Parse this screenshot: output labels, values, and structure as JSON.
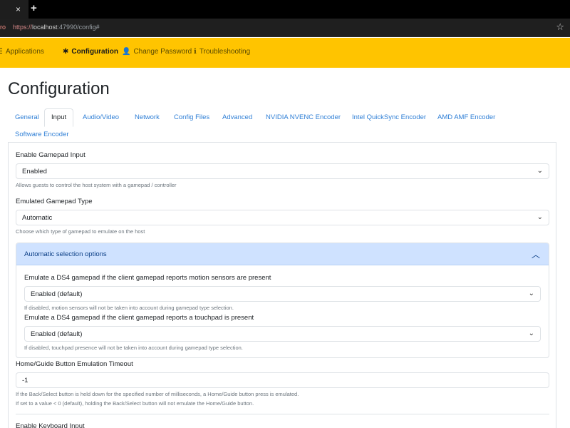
{
  "browser": {
    "tab_close": "×",
    "new_tab": "+",
    "addr_prefix": "ro",
    "url_scheme": "https://",
    "url_host": "localhost",
    "url_path": ":47990/config#",
    "bookmark_icon": "star-icon"
  },
  "navbar": {
    "items": [
      {
        "icon": "list-icon",
        "label": "Applications"
      },
      {
        "icon": "gear-icon",
        "label": "Configuration"
      },
      {
        "icon": "user-lock-icon",
        "label": "Change Password"
      },
      {
        "icon": "info-icon",
        "label": "Troubleshooting"
      }
    ],
    "active": "Configuration",
    "color": "#ffc400"
  },
  "page": {
    "title": "Configuration"
  },
  "tabs": [
    "General",
    "Input",
    "Audio/Video",
    "Network",
    "Config Files",
    "Advanced",
    "NVIDIA NVENC Encoder",
    "Intel QuickSync Encoder",
    "AMD AMF Encoder",
    "Software Encoder"
  ],
  "active_tab": "Input",
  "form": {
    "gamepad_input": {
      "label": "Enable Gamepad Input",
      "value": "Enabled",
      "help": "Allows guests to control the host system with a gamepad / controller"
    },
    "gamepad_type": {
      "label": "Emulated Gamepad Type",
      "value": "Automatic",
      "help": "Choose which type of gamepad to emulate on the host"
    },
    "auto_options": {
      "title": "Automatic selection options",
      "motion": {
        "label": "Emulate a DS4 gamepad if the client gamepad reports motion sensors are present",
        "value": "Enabled (default)",
        "help": "If disabled, motion sensors will not be taken into account during gamepad type selection."
      },
      "touchpad": {
        "label": "Emulate a DS4 gamepad if the client gamepad reports a touchpad is present",
        "value": "Enabled (default)",
        "help": "If disabled, touchpad presence will not be taken into account during gamepad type selection."
      }
    },
    "home_guide": {
      "label": "Home/Guide Button Emulation Timeout",
      "value": "-1",
      "help1": "If the Back/Select button is held down for the specified number of milliseconds, a Home/Guide button press is emulated.",
      "help2": "If set to a value < 0 (default), holding the Back/Select button will not emulate the Home/Guide button."
    },
    "keyboard": {
      "label": "Enable Keyboard Input"
    }
  }
}
